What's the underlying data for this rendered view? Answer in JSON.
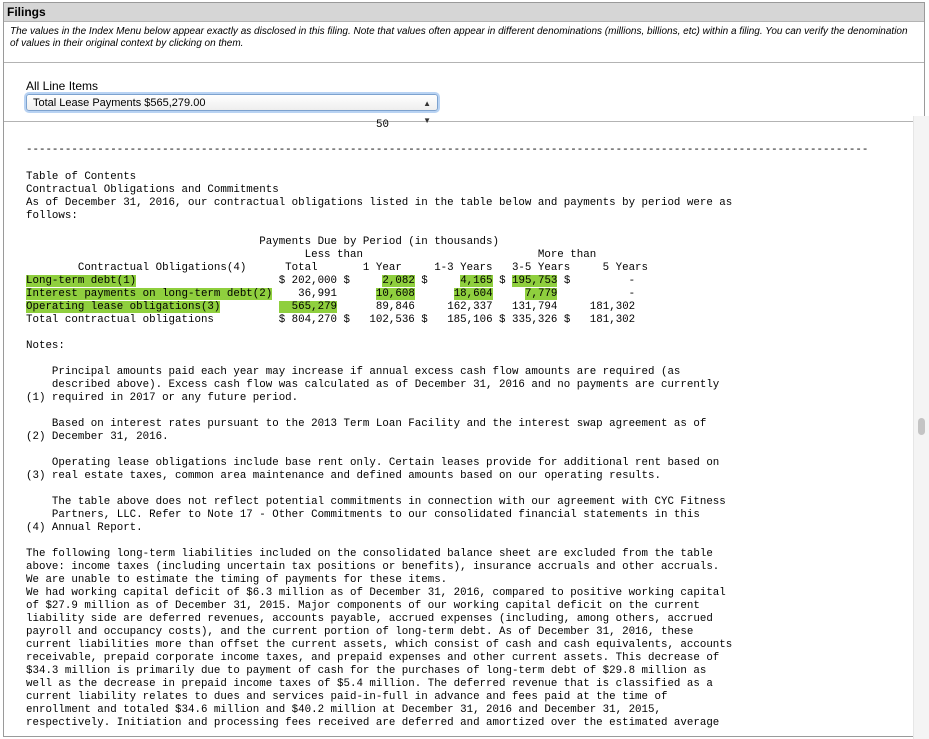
{
  "header": {
    "title": "Filings",
    "intro": "The values in the Index Menu below appear exactly as disclosed in this filing. Note that values often appear in different denominations (millions, billions, etc) within a filing. You can verify the denomination of values in their original context by clicking on them."
  },
  "menu": {
    "label": "All Line Items",
    "selected": "Total Lease Payments $565,279.00"
  },
  "document": {
    "page_number": "50",
    "separator": "----------------------------------------------------------------------------------------------------------------------------------",
    "toc_lines": [
      "Table of Contents",
      "Contractual Obligations and Commitments",
      "As of December 31, 2016, our contractual obligations listed in the table below and payments by period were as",
      "follows:"
    ],
    "table": {
      "header_lines": [
        "                                    Payments Due by Period (in thousands)",
        "                                           Less than                           More than",
        "        Contractual Obligations(4)      Total       1 Year     1-3 Years   3-5 Years     5 Years"
      ],
      "rows": [
        {
          "label": "Long-term debt(1)",
          "total": "$ 202,000",
          "y1": "$     2,082",
          "y13": "$     4,165",
          "y35": "$ 195,753",
          "more": "$         -",
          "highlight": true
        },
        {
          "label": "Interest payments on long-term debt(2)",
          "total": "   36,991",
          "y1": "     10,608",
          "y13": "     18,604",
          "y35": "    7,779",
          "more": "          -",
          "highlight": true
        },
        {
          "label": "Operating lease obligations(3)",
          "total": "  565,279",
          "y1": "     89,846",
          "y13": "    162,337",
          "y35": "  131,794",
          "more": "    181,302",
          "highlight": true
        },
        {
          "label": "Total contractual obligations",
          "total": "$ 804,270",
          "y1": "$   102,536",
          "y13": "$   185,106",
          "y35": "$ 335,326",
          "more": "$   181,302",
          "highlight": false
        }
      ]
    },
    "notes_heading": "Notes:",
    "notes": [
      {
        "num": "(1)",
        "lines": [
          "    Principal amounts paid each year may increase if annual excess cash flow amounts are required (as",
          "    described above). Excess cash flow was calculated as of December 31, 2016 and no payments are currently",
          "(1) required in 2017 or any future period."
        ]
      },
      {
        "num": "(2)",
        "lines": [
          "    Based on interest rates pursuant to the 2013 Term Loan Facility and the interest swap agreement as of",
          "(2) December 31, 2016."
        ]
      },
      {
        "num": "(3)",
        "lines": [
          "    Operating lease obligations include base rent only. Certain leases provide for additional rent based on",
          "(3) real estate taxes, common area maintenance and defined amounts based on our operating results."
        ]
      },
      {
        "num": "(4)",
        "lines": [
          "    The table above does not reflect potential commitments in connection with our agreement with CYC Fitness",
          "    Partners, LLC. Refer to Note 17 - Other Commitments to our consolidated financial statements in this",
          "(4) Annual Report."
        ]
      }
    ],
    "body_lines": [
      "The following long-term liabilities included on the consolidated balance sheet are excluded from the table",
      "above: income taxes (including uncertain tax positions or benefits), insurance accruals and other accruals.",
      "We are unable to estimate the timing of payments for these items.",
      "We had working capital deficit of $6.3 million as of December 31, 2016, compared to positive working capital",
      "of $27.9 million as of December 31, 2015. Major components of our working capital deficit on the current",
      "liability side are deferred revenues, accounts payable, accrued expenses (including, among others, accrued",
      "payroll and occupancy costs), and the current portion of long-term debt. As of December 31, 2016, these",
      "current liabilities more than offset the current assets, which consist of cash and cash equivalents, accounts",
      "receivable, prepaid corporate income taxes, and prepaid expenses and other current assets. This decrease of",
      "$34.3 million is primarily due to payment of cash for the purchases of long-term debt of $29.8 million as",
      "well as the decrease in prepaid income taxes of $5.4 million. The deferred revenue that is classified as a",
      "current liability relates to dues and services paid-in-full in advance and fees paid at the time of",
      "enrollment and totaled $34.6 million and $40.2 million at December 31, 2016 and December 31, 2015,",
      "respectively. Initiation and processing fees received are deferred and amortized over the estimated average"
    ]
  },
  "colors": {
    "highlight": "#8fcf3e",
    "titlebar": "#d6d6d6",
    "select_focus": "#b9d3f3"
  }
}
